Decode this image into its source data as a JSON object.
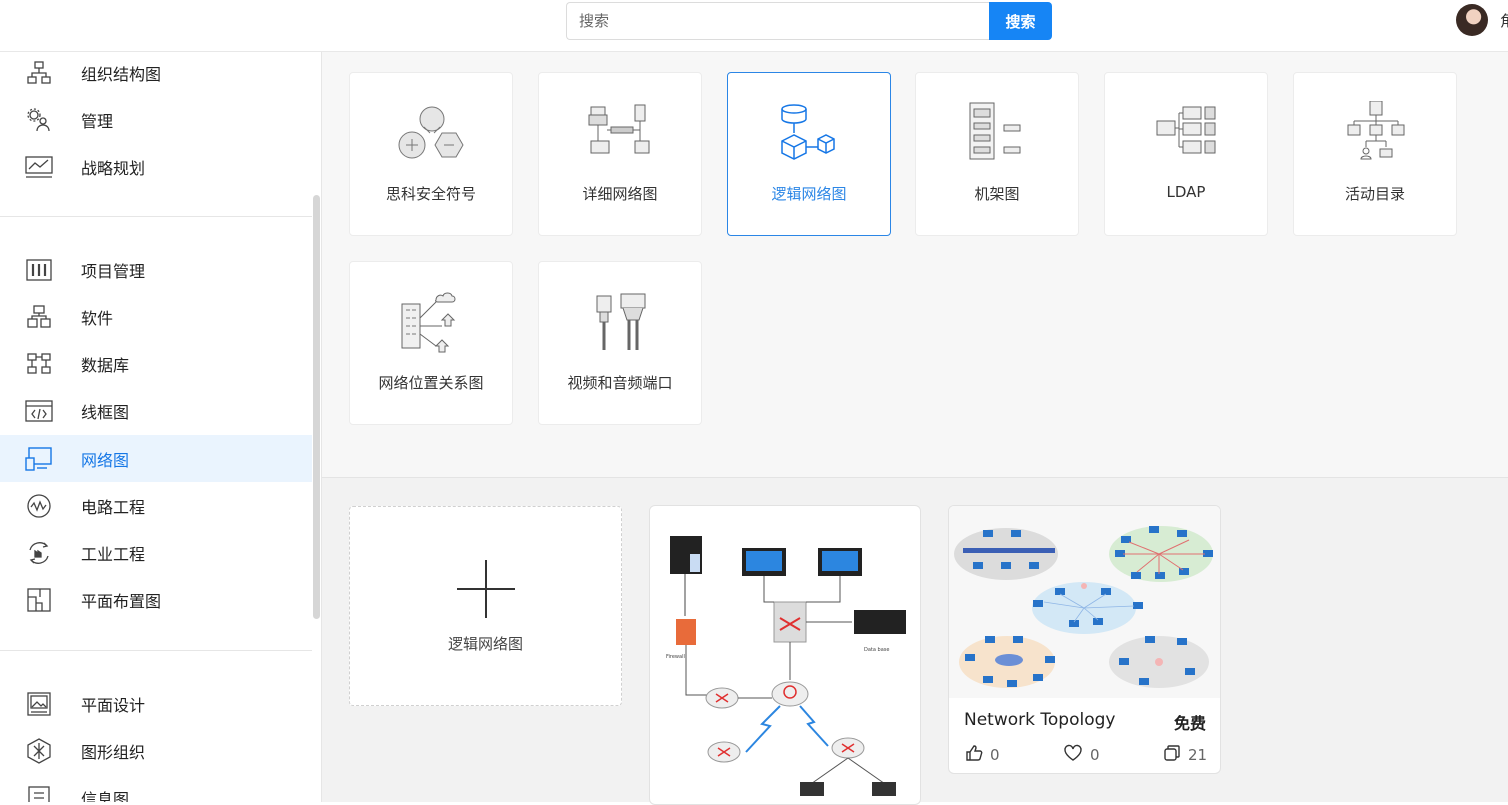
{
  "search": {
    "placeholder": "搜索",
    "button_label": "搜索"
  },
  "user": {
    "name": "角"
  },
  "sidebar": {
    "items": [
      {
        "label": "组织结构图",
        "icon": "org-chart-icon"
      },
      {
        "label": "管理",
        "icon": "gears-people-icon"
      },
      {
        "label": "战略规划",
        "icon": "strategy-chart-icon"
      },
      {
        "label": "项目管理",
        "icon": "project-columns-icon"
      },
      {
        "label": "软件",
        "icon": "software-blocks-icon"
      },
      {
        "label": "数据库",
        "icon": "database-flow-icon"
      },
      {
        "label": "线框图",
        "icon": "wireframe-code-icon"
      },
      {
        "label": "网络图",
        "icon": "network-devices-icon",
        "active": true
      },
      {
        "label": "电路工程",
        "icon": "circuit-wave-icon"
      },
      {
        "label": "工业工程",
        "icon": "industrial-cycle-icon"
      },
      {
        "label": "平面布置图",
        "icon": "floor-plan-icon"
      },
      {
        "label": "平面设计",
        "icon": "graphic-design-icon"
      },
      {
        "label": "图形组织",
        "icon": "graphic-organizer-icon"
      },
      {
        "label": "信息图",
        "icon": "infographic-icon"
      }
    ]
  },
  "templates": [
    {
      "label": "思科安全符号",
      "icon": "cisco-security-icon"
    },
    {
      "label": "详细网络图",
      "icon": "detailed-network-icon"
    },
    {
      "label": "逻辑网络图",
      "icon": "logical-network-icon",
      "selected": true
    },
    {
      "label": "机架图",
      "icon": "rack-icon"
    },
    {
      "label": "LDAP",
      "icon": "ldap-icon"
    },
    {
      "label": "活动目录",
      "icon": "active-directory-icon"
    },
    {
      "label": "网络位置关系图",
      "icon": "network-location-icon"
    },
    {
      "label": "视频和音频端口",
      "icon": "av-ports-icon"
    }
  ],
  "new_blank": {
    "label": "逻辑网络图"
  },
  "template_cards": [
    {
      "title": "",
      "thumbnail": "network-diagram-firewall-thumbnail",
      "thumb_text": [
        "Firewall",
        "Data base"
      ]
    },
    {
      "title": "Network Topology",
      "price": "免费",
      "likes": "0",
      "favorites": "0",
      "copies": "21",
      "thumbnail": "network-topology-thumbnail"
    }
  ],
  "colors": {
    "accent": "#1685f5",
    "active_bg": "#eaf4fe",
    "main_bg": "#f2f2f2"
  }
}
